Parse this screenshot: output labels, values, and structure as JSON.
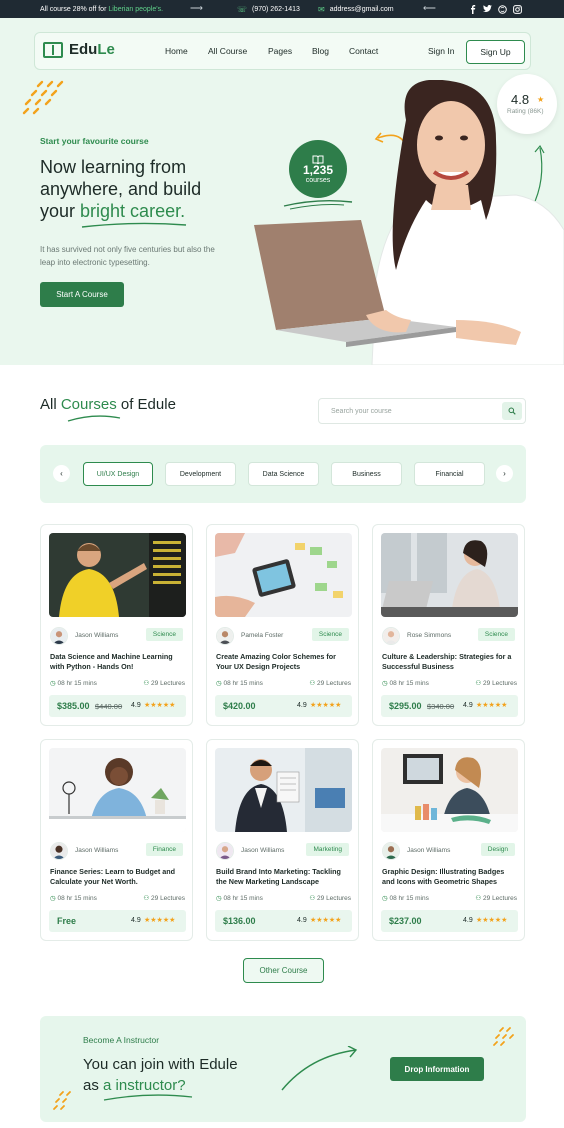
{
  "topbar": {
    "promo_prefix": "All course 28% off for",
    "promo_highlight": "Liberian people's.",
    "phone": "(970) 262-1413",
    "email": "address@gmail.com",
    "social_icons": [
      "facebook-icon",
      "twitter-icon",
      "skype-icon",
      "instagram-icon"
    ]
  },
  "nav": {
    "logo_prefix": "Edu",
    "logo_suffix": "Le",
    "items": [
      "Home",
      "All Course",
      "Pages",
      "Blog",
      "Contact"
    ],
    "signin": "Sign In",
    "signup": "Sign Up"
  },
  "hero": {
    "eyebrow": "Start your favourite course",
    "title_line1": "Now learning from",
    "title_line2": "anywhere, and build",
    "title_line3_prefix": "your ",
    "title_line3_highlight": "bright career.",
    "description": "It has survived not only five centuries but also the leap into electronic typesetting.",
    "cta": "Start A Course",
    "courses_count": "1,235",
    "courses_label": "courses",
    "rating_value": "4.8",
    "rating_label": "Rating (86K)"
  },
  "courses": {
    "title_prefix": "All ",
    "title_highlight": "Courses",
    "title_suffix": " of Edule",
    "search_placeholder": "Search your course",
    "categories": [
      "UI/UX Design",
      "Development",
      "Data Science",
      "Business",
      "Financial"
    ],
    "active_category": "UI/UX Design",
    "cards": [
      {
        "author": "Jason Williams",
        "tag": "Science",
        "title": "Data Science and Machine Learning with Python - Hands On!",
        "duration": "08 hr 15 mins",
        "lectures": "29 Lectures",
        "price": "$385.00",
        "old_price": "$440.00",
        "rating": "4.9",
        "stars": "★★★★★"
      },
      {
        "author": "Pamela Foster",
        "tag": "Science",
        "title": "Create Amazing Color Schemes for Your UX Design Projects",
        "duration": "08 hr 15 mins",
        "lectures": "29 Lectures",
        "price": "$420.00",
        "old_price": "",
        "rating": "4.9",
        "stars": "★★★★★"
      },
      {
        "author": "Rose Simmons",
        "tag": "Science",
        "title": "Culture & Leadership: Strategies for a Successful Business",
        "duration": "08 hr 15 mins",
        "lectures": "29 Lectures",
        "price": "$295.00",
        "old_price": "$340.00",
        "rating": "4.9",
        "stars": "★★★★★"
      },
      {
        "author": "Jason Williams",
        "tag": "Finance",
        "title": "Finance Series: Learn to Budget and Calculate your Net Worth.",
        "duration": "08 hr 15 mins",
        "lectures": "29 Lectures",
        "price": "Free",
        "old_price": "",
        "rating": "4.9",
        "stars": "★★★★★"
      },
      {
        "author": "Jason Williams",
        "tag": "Marketing",
        "title": "Build Brand Into Marketing: Tackling the New Marketing Landscape",
        "duration": "08 hr 15 mins",
        "lectures": "29 Lectures",
        "price": "$136.00",
        "old_price": "",
        "rating": "4.9",
        "stars": "★★★★★"
      },
      {
        "author": "Jason Williams",
        "tag": "Design",
        "title": "Graphic Design: Illustrating Badges and Icons with Geometric Shapes",
        "duration": "08 hr 15 mins",
        "lectures": "29 Lectures",
        "price": "$237.00",
        "old_price": "",
        "rating": "4.9",
        "stars": "★★★★★"
      }
    ],
    "more_button": "Other Course"
  },
  "instructor": {
    "eyebrow": "Become A Instructor",
    "title_line1": "You can join with Edule",
    "title_line2_prefix": "as ",
    "title_line2_highlight": "a instructor?",
    "cta": "Drop Information"
  },
  "colors": {
    "brand_green": "#2e7d4a",
    "accent_green": "#2e8b4e",
    "hero_bg": "#eaf7ee",
    "star": "#f3a21b",
    "dark": "#1f2a33"
  }
}
